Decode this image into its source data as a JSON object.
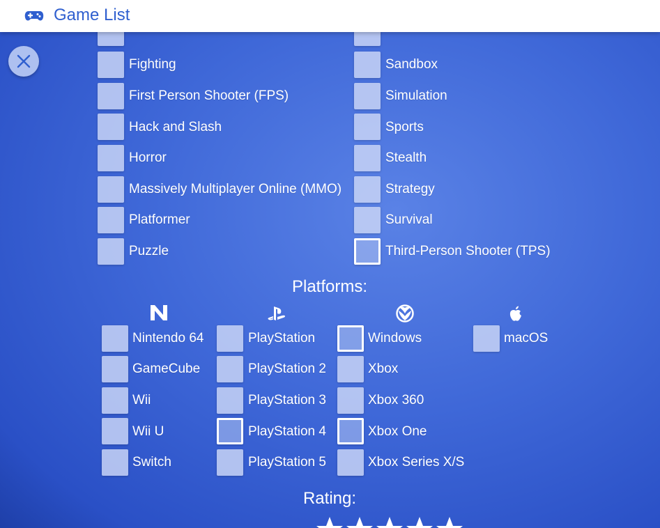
{
  "header": {
    "title": "Game List",
    "icon": "gamepad-icon"
  },
  "close": {
    "icon": "close-icon"
  },
  "genres": {
    "left": [
      "Fighting",
      "First Person Shooter (FPS)",
      "Hack and Slash",
      "Horror",
      "Massively Multiplayer Online (MMO)",
      "Platformer",
      "Puzzle"
    ],
    "right": [
      "Sandbox",
      "Simulation",
      "Sports",
      "Stealth",
      "Strategy",
      "Survival",
      "Third-Person Shooter (TPS)"
    ]
  },
  "platforms": {
    "title": "Platforms:",
    "nintendo": [
      "Nintendo 64",
      "GameCube",
      "Wii",
      "Wii U",
      "Switch"
    ],
    "playstation": [
      "PlayStation",
      "PlayStation 2",
      "PlayStation 3",
      "PlayStation 4",
      "PlayStation 5"
    ],
    "microsoft": [
      "Windows",
      "Xbox",
      "Xbox 360",
      "Xbox One",
      "Xbox Series X/S"
    ],
    "apple": [
      "macOS"
    ],
    "icons": [
      "nintendo-icon",
      "playstation-icon",
      "xbox-icon",
      "apple-icon"
    ]
  },
  "rating": {
    "title": "Rating:",
    "stars": 5
  }
}
